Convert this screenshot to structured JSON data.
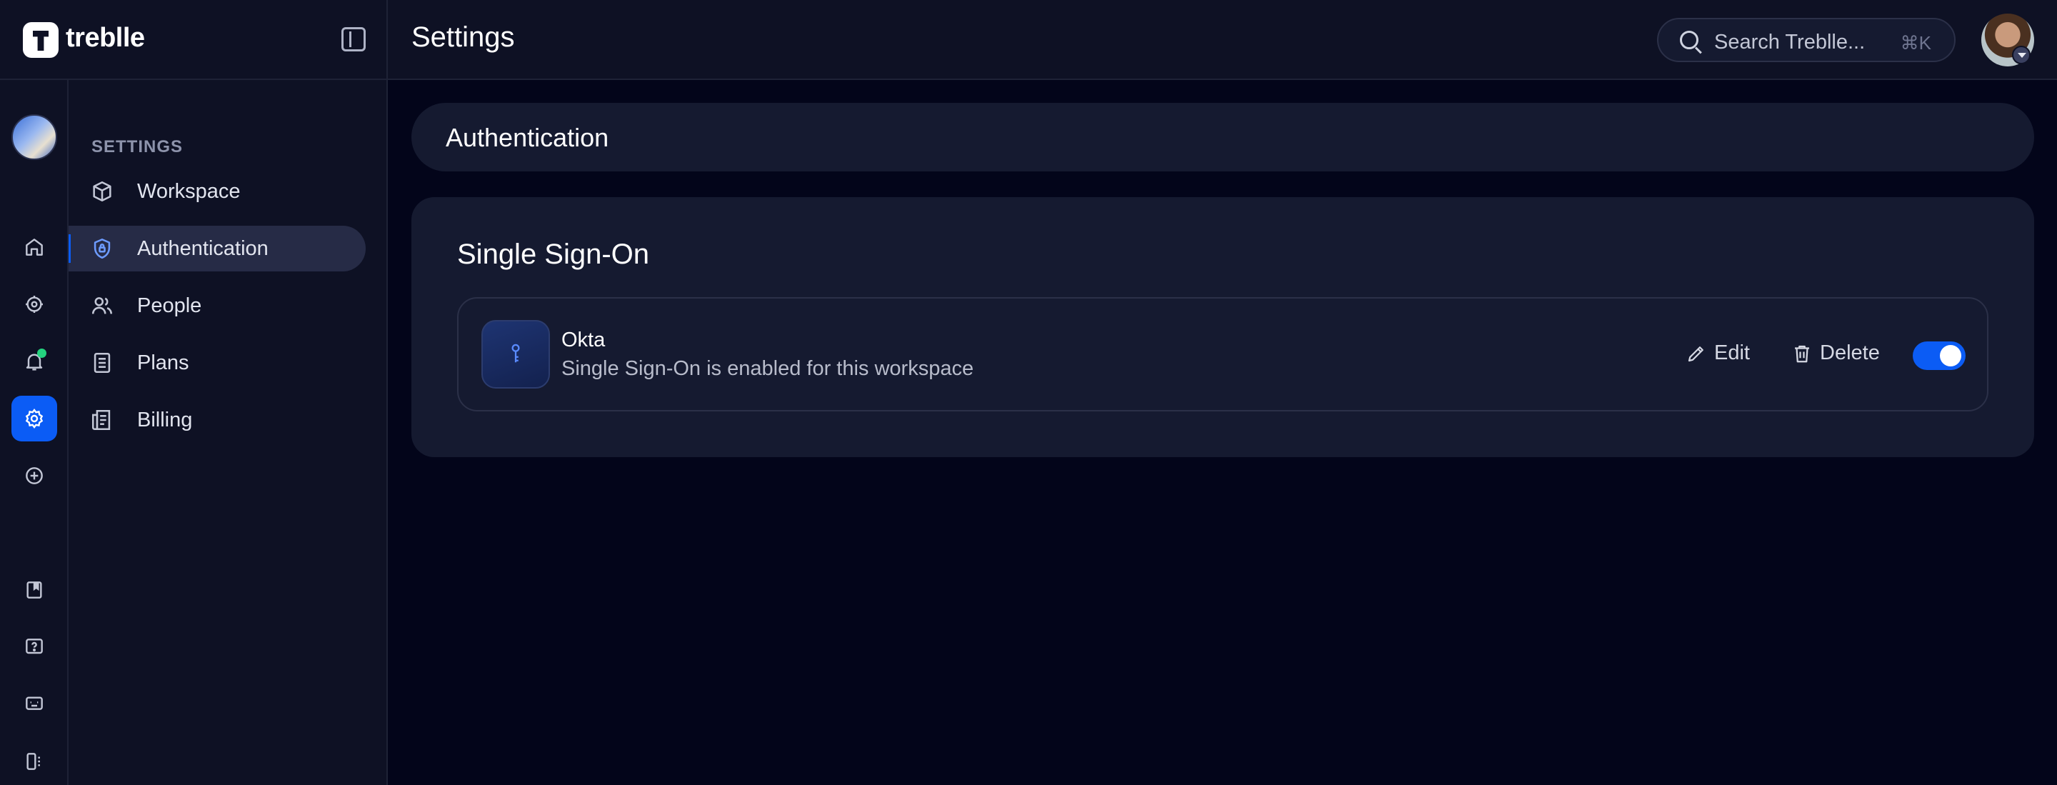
{
  "app": {
    "logo_text": "treblle"
  },
  "header": {
    "title": "Settings",
    "search": {
      "placeholder": "Search Treblle...",
      "shortcut": "⌘K"
    }
  },
  "rail": {
    "items": [
      {
        "name": "home",
        "icon": "home-icon"
      },
      {
        "name": "apis",
        "icon": "api-gear-icon"
      },
      {
        "name": "notifications",
        "icon": "bell-icon",
        "has_badge": true
      },
      {
        "name": "settings",
        "icon": "gear-icon",
        "active": true
      },
      {
        "name": "add",
        "icon": "plus-circle-icon"
      },
      {
        "name": "docs",
        "icon": "book-icon"
      },
      {
        "name": "help",
        "icon": "question-icon"
      },
      {
        "name": "chat",
        "icon": "chat-icon"
      },
      {
        "name": "apps",
        "icon": "apps-icon"
      }
    ]
  },
  "sidebar": {
    "heading": "SETTINGS",
    "items": [
      {
        "label": "Workspace",
        "icon": "cube-icon"
      },
      {
        "label": "Authentication",
        "icon": "shield-lock-icon",
        "active": true
      },
      {
        "label": "People",
        "icon": "people-icon"
      },
      {
        "label": "Plans",
        "icon": "document-icon"
      },
      {
        "label": "Billing",
        "icon": "receipt-icon"
      }
    ]
  },
  "main": {
    "section_title": "Authentication",
    "card": {
      "title": "Single Sign-On",
      "provider": {
        "name": "Okta",
        "description": "Single Sign-On is enabled for this workspace",
        "icon": "key-icon",
        "edit_label": "Edit",
        "delete_label": "Delete",
        "enabled": true
      }
    }
  },
  "colors": {
    "accent": "#0b5cf5",
    "background": "#03051a",
    "panel": "#151a30",
    "badge": "#24d37f"
  }
}
